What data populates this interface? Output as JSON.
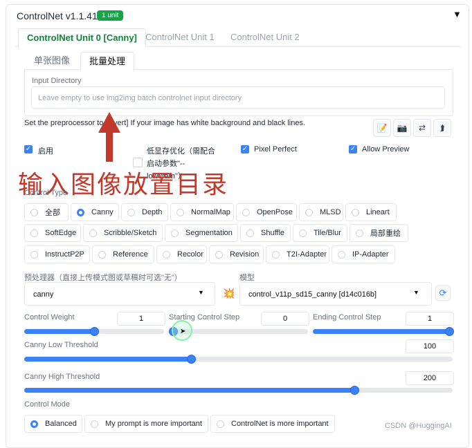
{
  "header": {
    "title": "ControlNet v1.1.417",
    "badge": "1 unit",
    "collapse_icon": "▼"
  },
  "unit_tabs": [
    {
      "label": "ControlNet Unit 0 [Canny]"
    },
    {
      "label": "ControlNet Unit 1"
    },
    {
      "label": "ControlNet Unit 2"
    }
  ],
  "mode_tabs": [
    {
      "label": "单张图像"
    },
    {
      "label": "批量处理"
    }
  ],
  "input_directory": {
    "label": "Input Directory",
    "placeholder": "Leave empty to use img2img batch controlnet input directory"
  },
  "preprocessor_hint": {
    "text": "Set the preprocessor to [invert] If your image has white background and black lines."
  },
  "tool_buttons": {
    "icons": [
      "📝",
      "📷",
      "⇄",
      "⮭"
    ],
    "names": [
      "edit-icon",
      "camera-icon",
      "swap-icon",
      "upload-icon"
    ]
  },
  "checkboxes": {
    "enable": "启用",
    "lowvram": "低显存优化（需配合启动参数\"--lowvram\"）",
    "lowvram_line1": "低显存优化（需配合",
    "lowvram_line2": "启动参数\"--",
    "lowvram_line3": "lowvram\"）",
    "pixel_perfect": "Pixel Perfect",
    "allow_preview": "Allow Preview"
  },
  "overlay_text": "输入图像放置目录",
  "control_type": {
    "label": "Control Type",
    "options": [
      "全部",
      "Canny",
      "Depth",
      "NormalMap",
      "OpenPose",
      "MLSD",
      "Lineart",
      "SoftEdge",
      "Scribble/Sketch",
      "Segmentation",
      "Shuffle",
      "Tile/Blur",
      "局部重绘",
      "InstructP2P",
      "Reference",
      "Recolor",
      "Revision",
      "T2I-Adapter",
      "IP-Adapter"
    ],
    "selected": "Canny"
  },
  "preprocessor": {
    "label": "预处理器（直接上传模式图或草稿时可选\"无\"）",
    "value": "canny"
  },
  "model": {
    "label": "模型",
    "value": "control_v11p_sd15_canny [d14c016b]"
  },
  "sliders": {
    "control_weight": {
      "label": "Control Weight",
      "value": "1",
      "fraction": 0.5
    },
    "starting_step": {
      "label": "Starting Control Step",
      "value": "0",
      "fraction": 0.0
    },
    "ending_step": {
      "label": "Ending Control Step",
      "value": "1",
      "fraction": 1.0
    },
    "low_threshold": {
      "label": "Canny Low Threshold",
      "value": "100",
      "fraction": 0.39
    },
    "high_threshold": {
      "label": "Canny High Threshold",
      "value": "200",
      "fraction": 0.77
    }
  },
  "control_mode": {
    "label": "Control Mode",
    "options": [
      "Balanced",
      "My prompt is more important",
      "ControlNet is more important"
    ],
    "selected": "Balanced"
  },
  "watermark": "CSDN @HuggingAI",
  "colors": {
    "accent": "#3b82f6",
    "brand_green": "#16a34a",
    "overlay_red": "#c0392b"
  }
}
